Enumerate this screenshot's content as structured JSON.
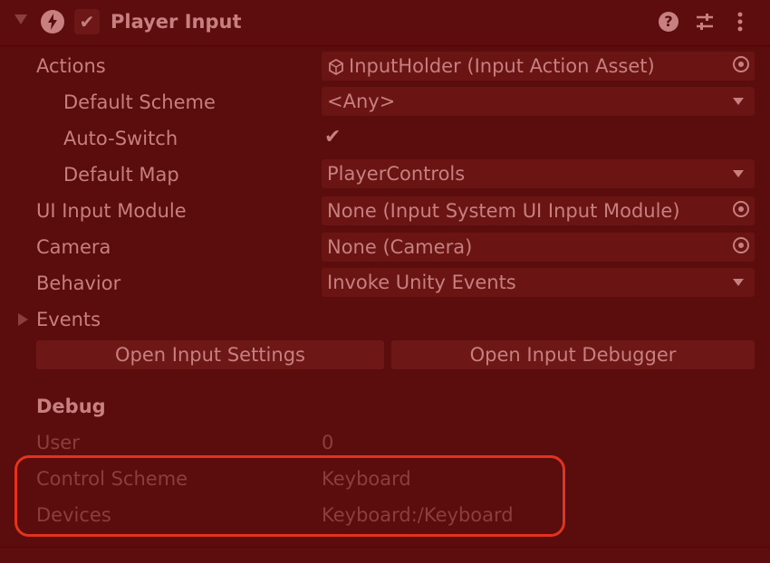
{
  "component": {
    "title": "Player Input",
    "enabled_check": "✔"
  },
  "rows": {
    "actions": {
      "label": "Actions",
      "value": "InputHolder (Input Action Asset)"
    },
    "default_scheme": {
      "label": "Default Scheme",
      "value": "<Any>"
    },
    "auto_switch": {
      "label": "Auto-Switch",
      "value": "✔"
    },
    "default_map": {
      "label": "Default Map",
      "value": "PlayerControls"
    },
    "ui_input_module": {
      "label": "UI Input Module",
      "value": "None (Input System UI Input Module)"
    },
    "camera": {
      "label": "Camera",
      "value": "None (Camera)"
    },
    "behavior": {
      "label": "Behavior",
      "value": "Invoke Unity Events"
    },
    "events": {
      "label": "Events"
    }
  },
  "buttons": {
    "open_settings": "Open Input Settings",
    "open_debugger": "Open Input Debugger"
  },
  "debug": {
    "heading": "Debug",
    "user": {
      "label": "User",
      "value": "0"
    },
    "control_scheme": {
      "label": "Control Scheme",
      "value": "Keyboard"
    },
    "devices": {
      "label": "Devices",
      "value": "Keyboard:/Keyboard"
    }
  },
  "colors": {
    "background": "#5b0c0c",
    "text": "#c77f7f",
    "highlight": "#e2331f"
  },
  "icons": [
    "foldout-arrow-icon",
    "input-component-icon",
    "help-icon",
    "settings-sliders-icon",
    "kebab-menu-icon",
    "asset-icon",
    "object-picker-icon",
    "dropdown-arrow-icon"
  ]
}
